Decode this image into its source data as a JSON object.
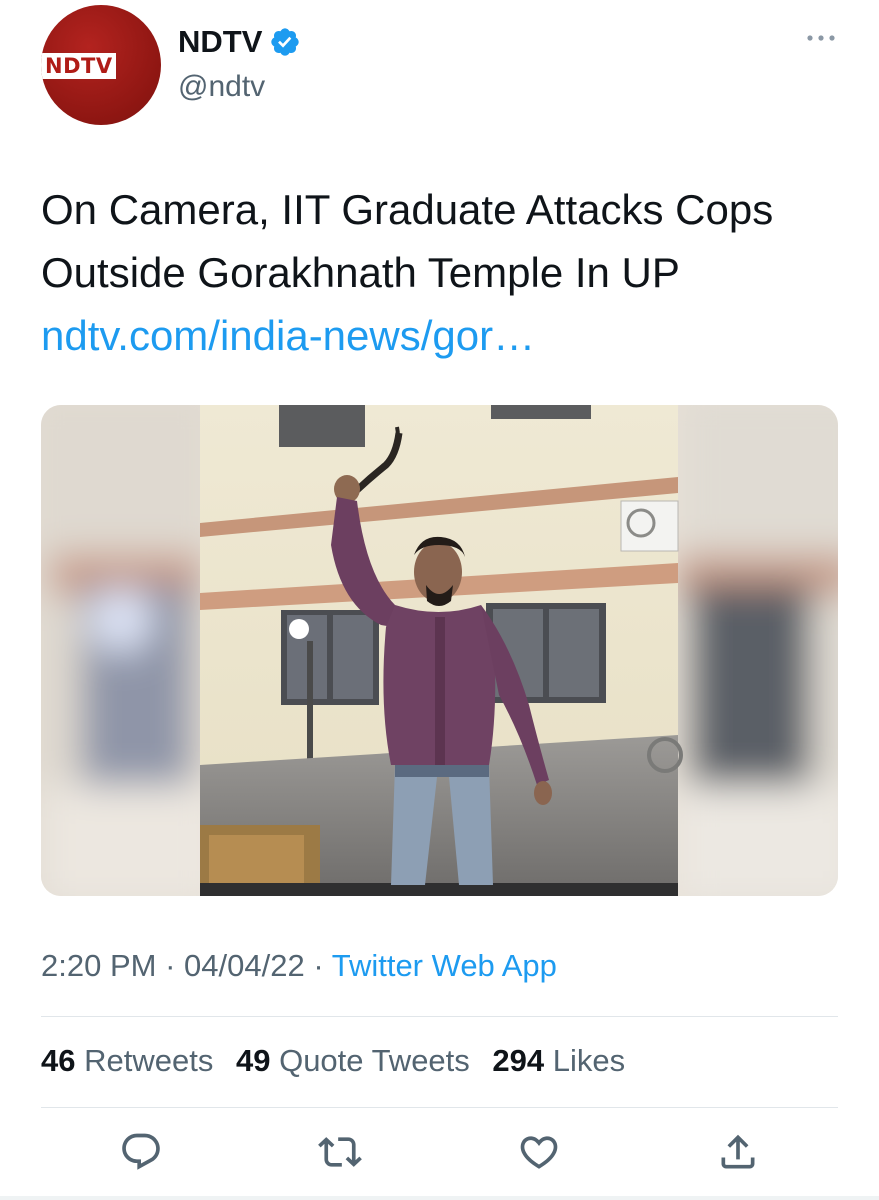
{
  "author": {
    "name": "NDTV",
    "handle": "@ndtv",
    "avatar_text": "NDTV",
    "verified": true
  },
  "tweet": {
    "text": "On Camera, IIT Graduate Attacks Cops Outside Gorakhnath Temple In UP",
    "link": "ndtv.com/india-news/gor…"
  },
  "meta": {
    "time": "2:20 PM",
    "separator": "·",
    "date": "04/04/22",
    "source": "Twitter Web App"
  },
  "stats": [
    {
      "count": "46",
      "label": "Retweets"
    },
    {
      "count": "49",
      "label": "Quote Tweets"
    },
    {
      "count": "294",
      "label": "Likes"
    }
  ],
  "actions": [
    {
      "icon": "reply-icon"
    },
    {
      "icon": "retweet-icon"
    },
    {
      "icon": "like-icon"
    },
    {
      "icon": "share-icon"
    }
  ],
  "colors": {
    "link": "#1d9bf0",
    "secondary_text": "#536471",
    "brand": "#b01c17"
  }
}
